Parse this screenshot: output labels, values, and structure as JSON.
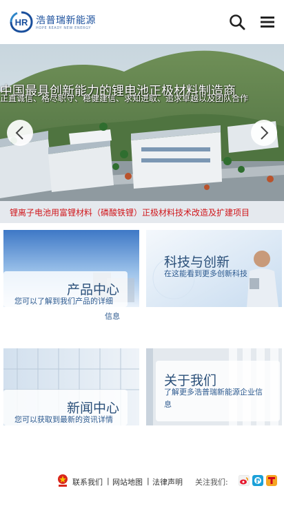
{
  "header": {
    "logo_cn": "浩普瑞新能源",
    "logo_en": "HOPE READY NEW ENERGY",
    "logo_mark": "HR",
    "search_icon": "search-icon",
    "menu_icon": "hamburger-menu-icon"
  },
  "banner": {
    "headline": "中国最具创新能力的锂电池正极材料制造商",
    "subline": "正直诚信、格尽职守、稳健建信、求知进取、追求卓越以及团队合作",
    "ticker": "锂离子电池用富锂材料（磷酸铁锂）正极材料技术改造及扩建项目",
    "prev_icon": "chevron-left-icon",
    "next_icon": "chevron-right-icon"
  },
  "cards": [
    {
      "title": "产品中心",
      "desc_line1": "您可以了解到我们产品的详细",
      "desc_line2": "信息"
    },
    {
      "title": "科技与创新",
      "desc_line1": "在这能看到更多创新科技"
    },
    {
      "title": "新闻中心",
      "desc_line1": "您可以获取到最新的资讯详情"
    },
    {
      "title": "关于我们",
      "desc_line1": "了解更多浩普瑞新能源企业信",
      "desc_line2": "息"
    }
  ],
  "footer": {
    "contact": "联系我们",
    "sitemap": "网站地图",
    "legal": "法律声明",
    "separator": "|",
    "follow": "关注我们:",
    "social": [
      "weibo-icon",
      "zhihu-icon",
      "tencent-weibo-icon"
    ]
  },
  "colors": {
    "brand_blue": "#1a4f9c",
    "ticker_red": "#d0161b",
    "card_title": "#2a4f79"
  }
}
